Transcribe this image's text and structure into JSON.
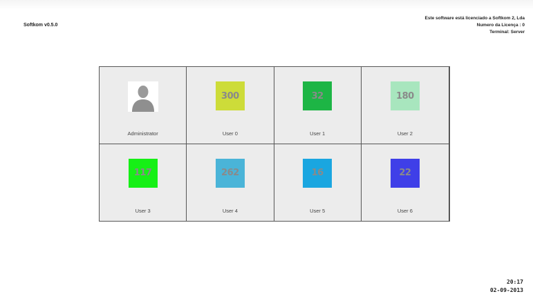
{
  "app": {
    "title": "Softkom v0.5.0"
  },
  "license": {
    "line1": "Este software está licenciado a Softkom 2, Lda",
    "line2": "Numero da Licença : 0",
    "line3": "Terminal: Server"
  },
  "users": [
    {
      "name": "Administrator",
      "count": "",
      "avatar": "person-silhouette-icon",
      "color": "#ffffff"
    },
    {
      "name": "User 0",
      "count": "300",
      "color": "#cddc39"
    },
    {
      "name": "User 1",
      "count": "32",
      "color": "#1db545"
    },
    {
      "name": "User 2",
      "count": "180",
      "color": "#a8e6be"
    },
    {
      "name": "User 3",
      "count": "117",
      "color": "#16f016"
    },
    {
      "name": "User 4",
      "count": "262",
      "color": "#4ab4d8"
    },
    {
      "name": "User 5",
      "count": "16",
      "color": "#1aa6e0"
    },
    {
      "name": "User 6",
      "count": "22",
      "color": "#3f3fe8"
    }
  ],
  "clock": {
    "time": "20:17",
    "date": "02-09-2013"
  }
}
